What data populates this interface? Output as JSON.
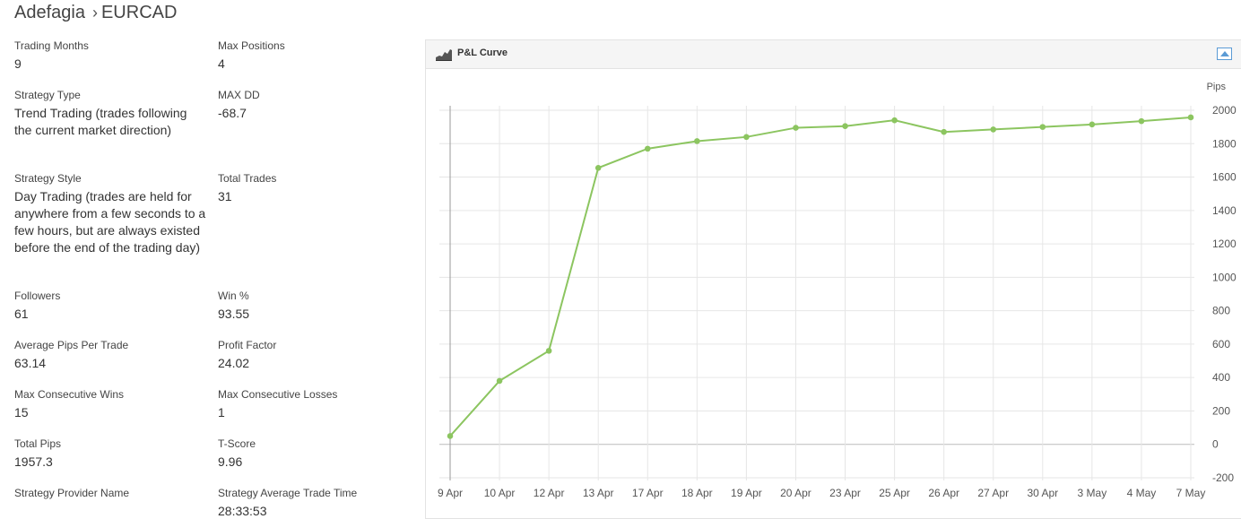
{
  "breadcrumb": {
    "provider": "Adefagia",
    "separator": "›",
    "symbol": "EURCAD"
  },
  "stats": [
    [
      {
        "label": "Trading Months",
        "value": "9"
      },
      {
        "label": "Max Positions",
        "value": "4"
      }
    ],
    [
      {
        "label": "Strategy Type",
        "value": "Trend Trading (trades following the current market direction)"
      },
      {
        "label": "MAX DD",
        "value": "-68.7"
      }
    ],
    [
      {
        "label": "Strategy Style",
        "value": "Day Trading (trades are held for anywhere from a few seconds to a few hours, but are always existed before the end of the trading day)"
      },
      {
        "label": "Total Trades",
        "value": "31"
      }
    ],
    [
      {
        "label": "Followers",
        "value": "61"
      },
      {
        "label": "Win %",
        "value": "93.55"
      }
    ],
    [
      {
        "label": "Average Pips Per Trade",
        "value": "63.14"
      },
      {
        "label": "Profit Factor",
        "value": "24.02"
      }
    ],
    [
      {
        "label": "Max Consecutive Wins",
        "value": "15"
      },
      {
        "label": "Max Consecutive Losses",
        "value": "1"
      }
    ],
    [
      {
        "label": "Total Pips",
        "value": "1957.3"
      },
      {
        "label": "T-Score",
        "value": "9.96"
      }
    ],
    [
      {
        "label": "Strategy Provider Name",
        "value": ""
      },
      {
        "label": "Strategy Average Trade Time",
        "value": "28:33:53"
      }
    ]
  ],
  "panel": {
    "title": "P&L Curve",
    "icon": "area-chart-icon",
    "collapse_icon": "collapse-up-icon"
  },
  "chart_data": {
    "type": "line",
    "title": "",
    "xlabel": "",
    "ylabel": "Pips",
    "categories": [
      "9 Apr",
      "10 Apr",
      "12 Apr",
      "13 Apr",
      "17 Apr",
      "18 Apr",
      "19 Apr",
      "20 Apr",
      "23 Apr",
      "25 Apr",
      "26 Apr",
      "27 Apr",
      "30 Apr",
      "3 May",
      "4 May",
      "7 May"
    ],
    "series": [
      {
        "values": [
          50,
          380,
          560,
          1655,
          1770,
          1815,
          1840,
          1895,
          1905,
          1940,
          1870,
          1885,
          1900,
          1915,
          1935,
          1957.3
        ]
      }
    ],
    "ylim": [
      -200,
      2000
    ],
    "yticks": [
      -200,
      0,
      200,
      400,
      600,
      800,
      1000,
      1200,
      1400,
      1600,
      1800,
      2000
    ],
    "y_axis_side": "right",
    "grid": true,
    "line_color": "#8cc560",
    "grid_color": "#e6e6e6",
    "zero_line_color": "#bbbbbb"
  }
}
